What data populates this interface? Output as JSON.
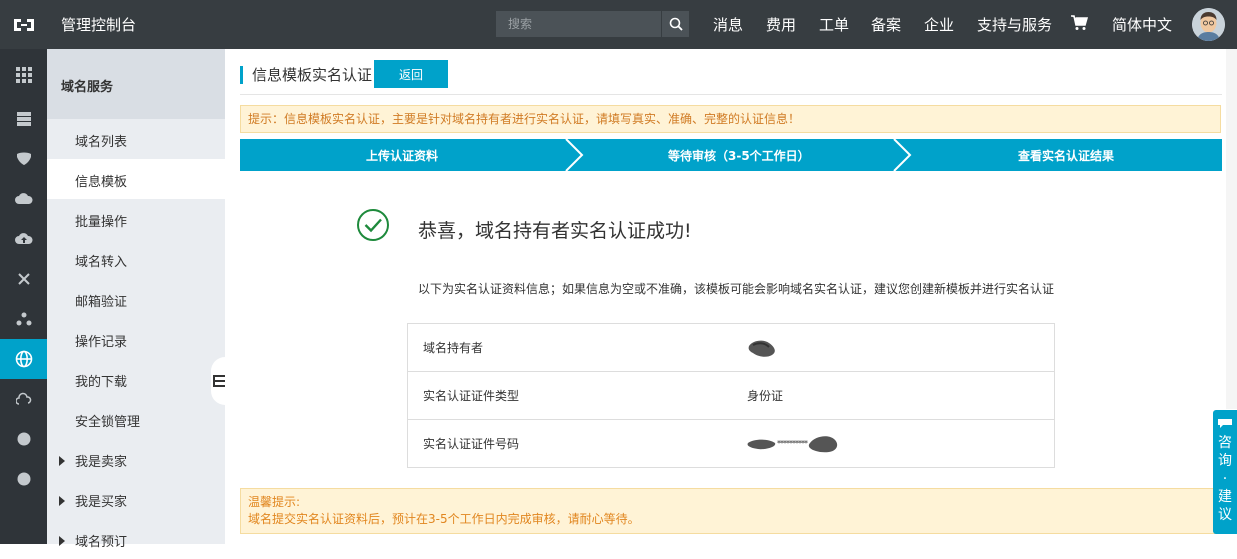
{
  "topbar": {
    "console_title": "管理控制台",
    "search_placeholder": "搜索",
    "nav": [
      "消息",
      "费用",
      "工单",
      "备案",
      "企业",
      "支持与服务",
      "简体中文"
    ]
  },
  "sidebar": {
    "section_title": "域名服务",
    "items": [
      {
        "label": "域名列表"
      },
      {
        "label": "信息模板"
      },
      {
        "label": "批量操作"
      },
      {
        "label": "域名转入"
      },
      {
        "label": "邮箱验证"
      },
      {
        "label": "操作记录"
      },
      {
        "label": "我的下载"
      },
      {
        "label": "安全锁管理"
      },
      {
        "label": "我是卖家"
      },
      {
        "label": "我是买家"
      },
      {
        "label": "域名预订"
      }
    ],
    "active_index": 1
  },
  "main": {
    "page_title": "信息模板实名认证",
    "back_label": "返回",
    "tip": "提示：信息模板实名认证，主要是针对域名持有者进行实名认证，请填写真实、准确、完整的认证信息！",
    "steps": [
      "上传认证资料",
      "等待审核（3-5个工作日）",
      "查看实名认证结果"
    ],
    "success_message": "恭喜，域名持有者实名认证成功!",
    "info_note": "以下为实名认证资料信息；如果信息为空或不准确，该模板可能会影响域名实名认证，建议您创建新模板并进行实名认证",
    "info_rows": [
      {
        "key": "域名持有者",
        "value": ""
      },
      {
        "key": "实名认证证件类型",
        "value": "身份证"
      },
      {
        "key": "实名认证证件号码",
        "value": "**********"
      }
    ],
    "notice_title": "温馨提示:",
    "notice_body": "域名提交实名认证资料后，预计在3-5个工作日内完成审核，请耐心等待。"
  },
  "consult_label": [
    "咨",
    "询",
    "·",
    "建",
    "议"
  ],
  "colors": {
    "accent": "#00a2ca",
    "topbar": "#373d41",
    "rail": "#2f3439",
    "warning": "#d07b24"
  }
}
